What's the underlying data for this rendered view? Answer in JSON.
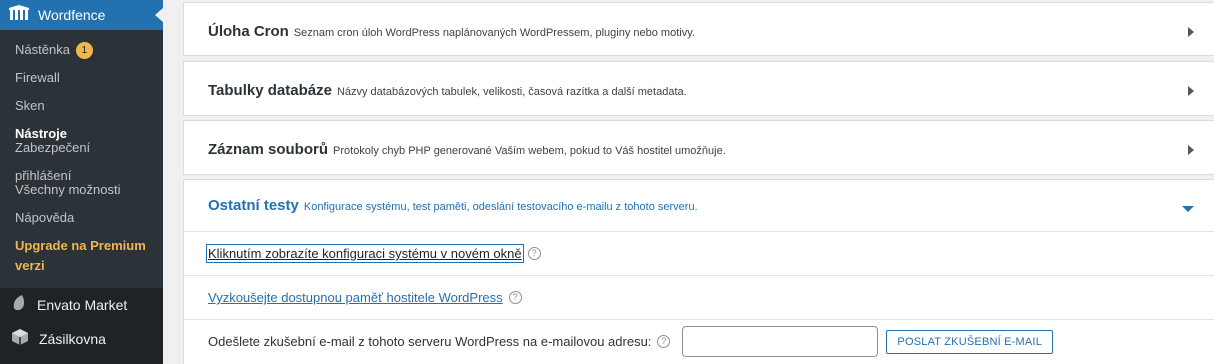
{
  "sidebar": {
    "active_menu": "Wordfence",
    "submenu": [
      {
        "label": "Nástěnka",
        "badge": "1"
      },
      {
        "label": "Firewall"
      },
      {
        "label": "Sken"
      },
      {
        "label": "Nástroje"
      },
      {
        "label": "Zabezpečení přihlášení"
      },
      {
        "label": "Všechny možnosti"
      },
      {
        "label": "Nápověda"
      },
      {
        "label": "Upgrade na Premium verzi"
      }
    ],
    "menus": [
      {
        "label": "Envato Market"
      },
      {
        "label": "Zásilkovna"
      }
    ]
  },
  "sections": [
    {
      "title": "Úloha Cron",
      "description": "Seznam cron úloh WordPress naplánovaných WordPressem, pluginy nebo motivy."
    },
    {
      "title": "Tabulky databáze",
      "description": "Názvy databázových tabulek, velikosti, časová razítka a další metadata."
    },
    {
      "title": "Záznam souborů",
      "description": "Protokoly chyb PHP generované Vaším webem, pokud to Váš hostitel umožňuje."
    },
    {
      "title": "Ostatní testy",
      "description": "Konfigurace systému, test paměti, odeslání testovacího e-mailu z tohoto serveru."
    }
  ],
  "other_tests": {
    "config_link": "Kliknutím zobrazíte konfiguraci systému v novém okně",
    "memory_link": "Vyzkoušejte dostupnou paměť hostitele WordPress",
    "email_label": "Odešlete zkušební e-mail z tohoto serveru WordPress na e-mailovou adresu:",
    "email_value": "",
    "send_button": "POSLAT ZKUŠEBNÍ E-MAIL",
    "help_glyph": "?"
  },
  "colors": {
    "accent": "#2271b1",
    "sidebar_bg": "#1d2327",
    "badge": "#f0b849"
  }
}
